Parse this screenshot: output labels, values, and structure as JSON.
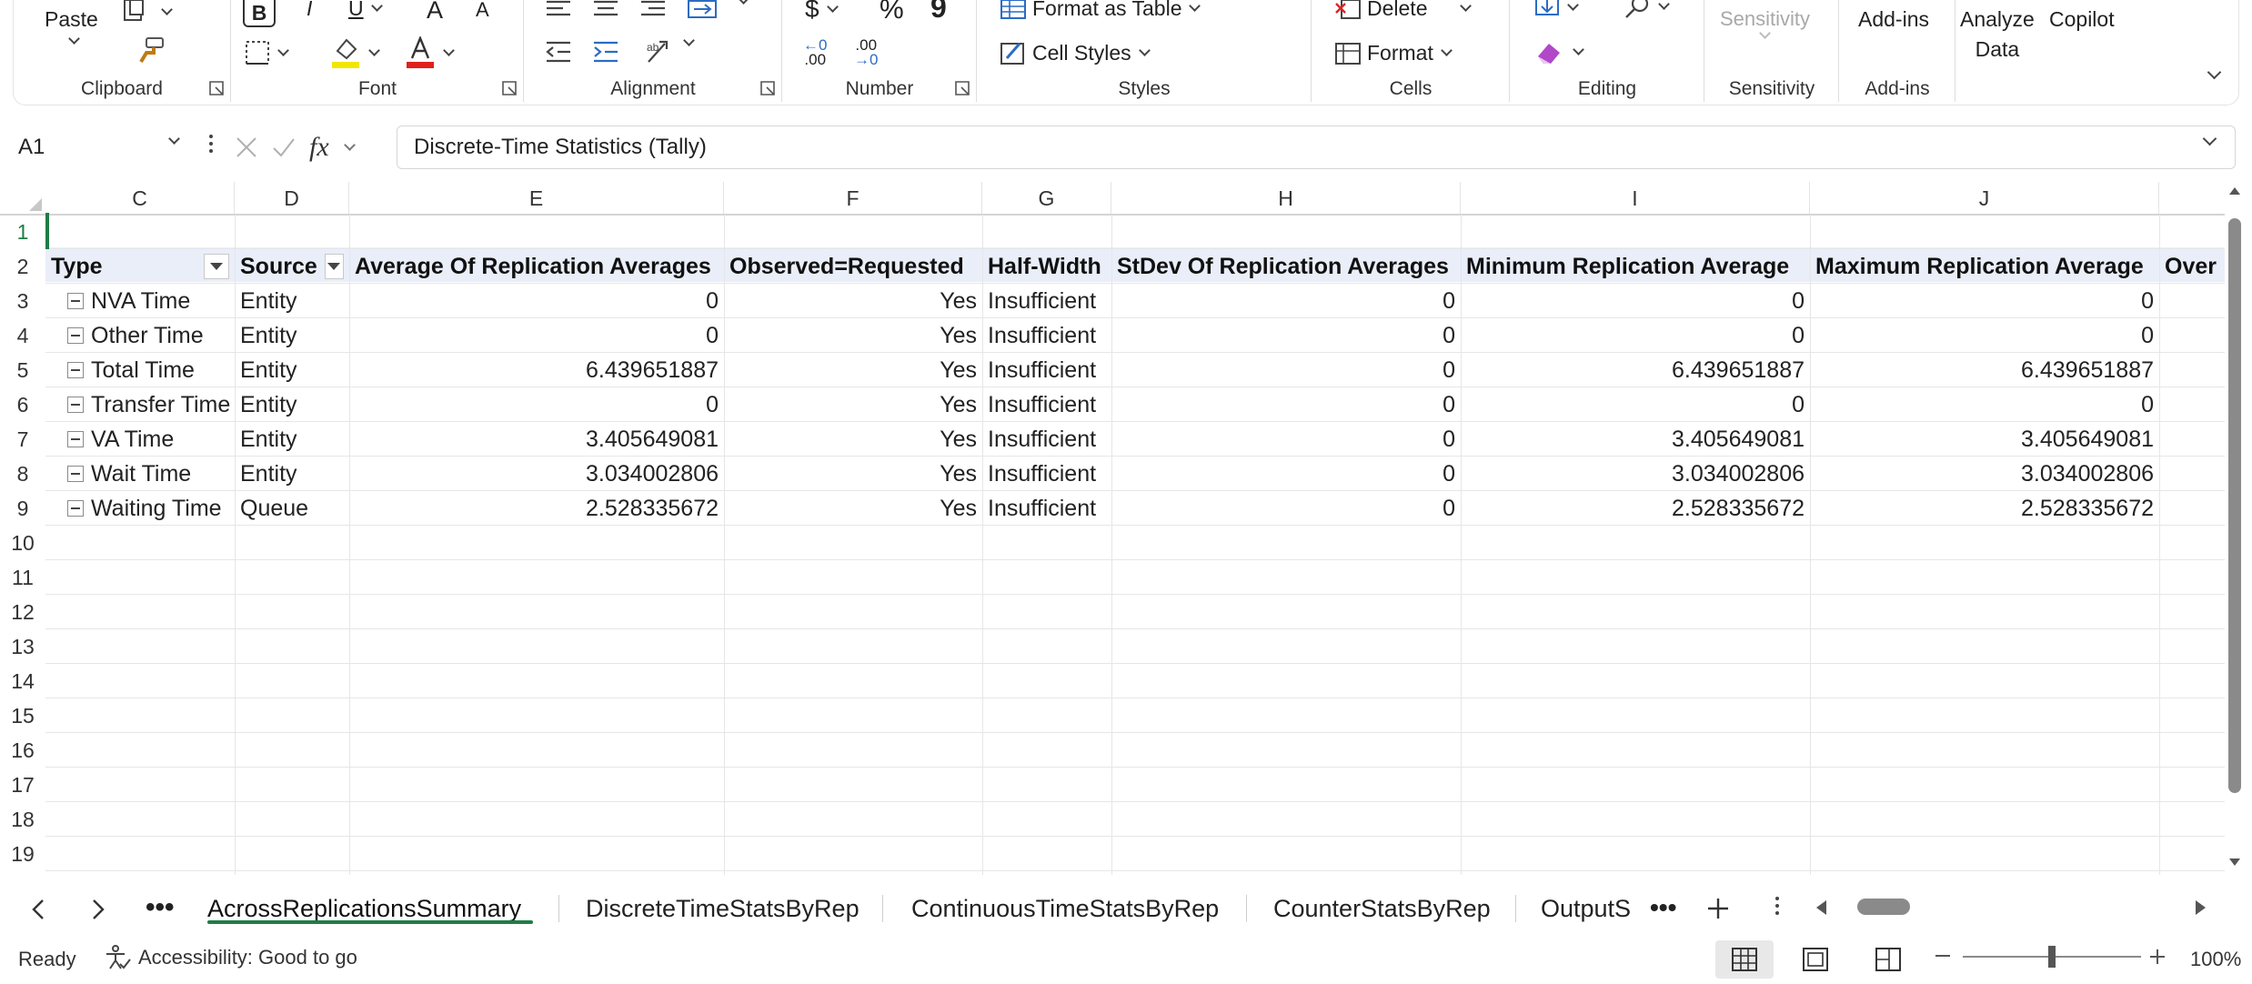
{
  "ribbon": {
    "clipboard": {
      "paste": "Paste",
      "label": "Clipboard"
    },
    "font": {
      "bold": "B",
      "italic": "I",
      "underline": "U",
      "grow": "A",
      "shrink": "A",
      "label": "Font",
      "highlight_color": "#f2e600",
      "font_color": "#e0201b"
    },
    "alignment": {
      "label": "Alignment"
    },
    "number": {
      "currency": "$",
      "percent": "%",
      "comma": "9",
      "inc_decimal": ".00",
      "dec_decimal": ".00",
      "label": "Number"
    },
    "styles": {
      "format_as_table": "Format as Table",
      "cell_styles": "Cell Styles",
      "label": "Styles"
    },
    "cells": {
      "delete": "Delete",
      "format": "Format",
      "label": "Cells"
    },
    "editing": {
      "label": "Editing"
    },
    "sensitivity": {
      "button": "Sensitivity",
      "label": "Sensitivity"
    },
    "addins": {
      "button": "Add-ins",
      "label": "Add-ins"
    },
    "analyze": {
      "line1": "Analyze",
      "line2": "Data"
    },
    "copilot": {
      "label": "Copilot"
    }
  },
  "formula_bar": {
    "name_box": "A1",
    "fx": "fx",
    "formula": "Discrete-Time Statistics (Tally)"
  },
  "columns": [
    "C",
    "D",
    "E",
    "F",
    "G",
    "H",
    "I",
    "J"
  ],
  "row_numbers": [
    "1",
    "2",
    "3",
    "4",
    "5",
    "6",
    "7",
    "8",
    "9",
    "10",
    "11",
    "12",
    "13",
    "14",
    "15",
    "16",
    "17",
    "18",
    "19"
  ],
  "table": {
    "headers": [
      "Type",
      "Source",
      "Average Of Replication Averages",
      "Observed=Requested",
      "Half-Width",
      "StDev Of Replication Averages",
      "Minimum Replication Average",
      "Maximum Replication Average",
      "Over"
    ],
    "rows": [
      [
        "NVA Time",
        "Entity",
        "0",
        "Yes",
        "Insufficient",
        "0",
        "0",
        "0"
      ],
      [
        "Other Time",
        "Entity",
        "0",
        "Yes",
        "Insufficient",
        "0",
        "0",
        "0"
      ],
      [
        "Total Time",
        "Entity",
        "6.439651887",
        "Yes",
        "Insufficient",
        "0",
        "6.439651887",
        "6.439651887"
      ],
      [
        "Transfer Time",
        "Entity",
        "0",
        "Yes",
        "Insufficient",
        "0",
        "0",
        "0"
      ],
      [
        "VA Time",
        "Entity",
        "3.405649081",
        "Yes",
        "Insufficient",
        "0",
        "3.405649081",
        "3.405649081"
      ],
      [
        "Wait Time",
        "Entity",
        "3.034002806",
        "Yes",
        "Insufficient",
        "0",
        "3.034002806",
        "3.034002806"
      ],
      [
        "Waiting Time",
        "Queue",
        "2.528335672",
        "Yes",
        "Insufficient",
        "0",
        "2.528335672",
        "2.528335672"
      ]
    ]
  },
  "sheet_tabs": [
    "AcrossReplicationsSummary",
    "DiscreteTimeStatsByRep",
    "ContinuousTimeStatsByRep",
    "CounterStatsByRep",
    "OutputS"
  ],
  "active_tab": "AcrossReplicationsSummary",
  "status": {
    "ready": "Ready",
    "accessibility": "Accessibility: Good to go",
    "zoom": "100%",
    "zoom_level": 1.0
  },
  "colors": {
    "accent": "#1e7d45",
    "table_header_band": "#e9eef9"
  }
}
